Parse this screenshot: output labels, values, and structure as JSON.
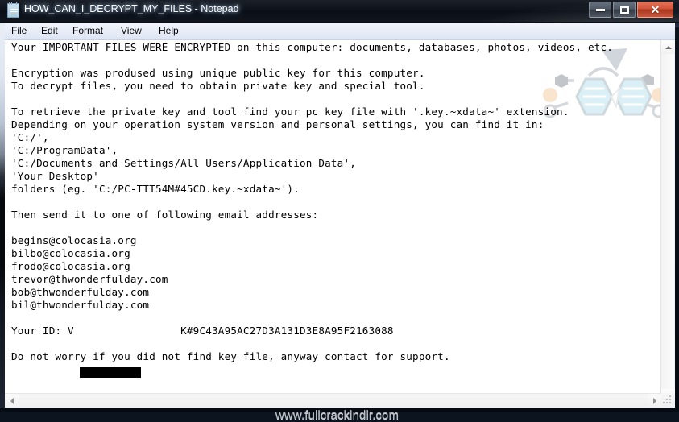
{
  "window": {
    "title": "HOW_CAN_I_DECRYPT_MY_FILES - Notepad",
    "icon": "notepad-icon",
    "controls": {
      "minimize": "—",
      "maximize": "□",
      "close": "✕"
    }
  },
  "menubar": {
    "items": [
      {
        "label": "File",
        "accel": "F"
      },
      {
        "label": "Edit",
        "accel": "E"
      },
      {
        "label": "Format",
        "accel": "o"
      },
      {
        "label": "View",
        "accel": "V"
      },
      {
        "label": "Help",
        "accel": "H"
      }
    ]
  },
  "document": {
    "lines": [
      "Your IMPORTANT FILES WERE ENCRYPTED on this computer: documents, databases, photos, videos, etc.",
      "",
      "Encryption was prodused using unique public key for this computer.",
      "To decrypt files, you need to obtain private key and special tool.",
      "",
      "To retrieve the private key and tool find your pc key file with '.key.~xdata~' extension.",
      "Depending on your operation system version and personal settings, you can find it in:",
      "'C:/',",
      "'C:/ProgramData',",
      "'C:/Documents and Settings/All Users/Application Data',",
      "'Your Desktop'",
      "folders (eg. 'C:/PC-TTT54M#45CD.key.~xdata~').",
      "",
      "Then send it to one of following email addresses:",
      "",
      "begins@colocasia.org",
      "bilbo@colocasia.org",
      "frodo@colocasia.org",
      "trevor@thwonderfulday.com",
      "bob@thwonderfulday.com",
      "bil@thwonderfulday.com",
      "",
      "Your ID: V█████████K#9C43A95AC27D3A131D3E8A95F2163088",
      "",
      "Do not worry if you did not find key file, anyway contact for support."
    ],
    "full_text": "Your IMPORTANT FILES WERE ENCRYPTED on this computer: documents, databases, photos, videos, etc.\n\nEncryption was prodused using unique public key for this computer.\nTo decrypt files, you need to obtain private key and special tool.\n\nTo retrieve the private key and tool find your pc key file with '.key.~xdata~' extension.\nDepending on your operation system version and personal settings, you can find it in:\n'C:/',\n'C:/ProgramData',\n'C:/Documents and Settings/All Users/Application Data',\n'Your Desktop'\nfolders (eg. 'C:/PC-TTT54M#45CD.key.~xdata~').\n\nThen send it to one of following email addresses:\n\nbegins@colocasia.org\nbilbo@colocasia.org\nfrodo@colocasia.org\ntrevor@thwonderfulday.com\nbob@thwonderfulday.com\nbil@thwonderfulday.com\n\nYour ID: V                 K#9C43A95AC27D3A131D3E8A95F2163088\n\nDo not worry if you did not find key file, anyway contact for support.",
    "emails": [
      "begins@colocasia.org",
      "bilbo@colocasia.org",
      "frodo@colocasia.org",
      "trevor@thwonderfulday.com",
      "bob@thwonderfulday.com",
      "bil@thwonderfulday.com"
    ],
    "paths": [
      "'C:/',",
      "'C:/ProgramData',",
      "'C:/Documents and Settings/All Users/Application Data',",
      "'Your Desktop'"
    ],
    "key_extension": ".key.~xdata~",
    "key_example": "C:/PC-TTT54M#45CD.key.~xdata~",
    "victim_id_visible": "K#9C43A95AC27D3A131D3E8A95F2163088",
    "victim_id_prefix": "V",
    "redacted": true
  },
  "watermark": {
    "text": "www.fullcrackindir.com"
  },
  "colors": {
    "titlebar": "#0a0f17",
    "menubar": "#e7ecf7",
    "editor_bg": "#ffffff",
    "text": "#000000",
    "close_button": "#c2452a",
    "watermark_text": "#b9bcc2",
    "deco_hex_fill": "#a8ddeb",
    "deco_line": "#9aa2ac",
    "deco_accent": "#f3c08a"
  },
  "scrollbars": {
    "vertical": {
      "up": "scroll-up-arrow",
      "down": "scroll-down-arrow"
    },
    "horizontal": {
      "left": "scroll-left-arrow",
      "right": "scroll-right-arrow"
    }
  }
}
